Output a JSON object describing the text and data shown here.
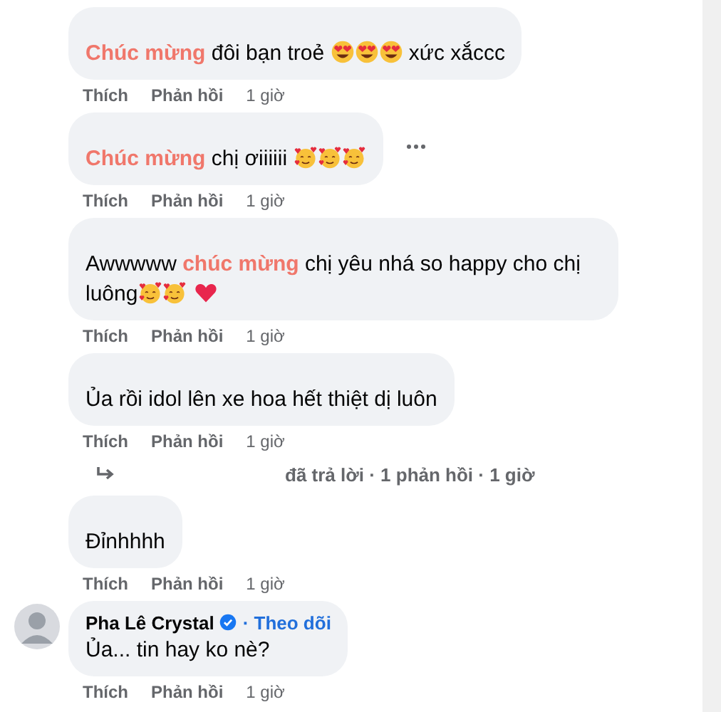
{
  "comments": [
    {
      "parts": [
        {
          "kind": "highlight",
          "text": "Chúc mừng"
        },
        {
          "kind": "text",
          "text": " đôi bạn troẻ "
        },
        {
          "kind": "emoji_heart_eyes"
        },
        {
          "kind": "emoji_heart_eyes"
        },
        {
          "kind": "emoji_heart_eyes"
        },
        {
          "kind": "text",
          "text": " xức xắccc"
        }
      ],
      "actions": [
        "Thích",
        "Phản hồi",
        "1 giờ"
      ],
      "more": false
    },
    {
      "parts": [
        {
          "kind": "highlight",
          "text": "Chúc mừng"
        },
        {
          "kind": "text",
          "text": " chị ơiiiiii "
        },
        {
          "kind": "emoji_hearts_face"
        },
        {
          "kind": "emoji_hearts_face"
        },
        {
          "kind": "emoji_hearts_face"
        }
      ],
      "actions": [
        "Thích",
        "Phản hồi",
        "1 giờ"
      ],
      "more": true
    },
    {
      "parts": [
        {
          "kind": "text",
          "text": "Awwwww "
        },
        {
          "kind": "highlight",
          "text": "chúc mừng"
        },
        {
          "kind": "text",
          "text": " chị yêu nhá so happy cho chị luông"
        },
        {
          "kind": "emoji_hearts_face"
        },
        {
          "kind": "emoji_hearts_face"
        },
        {
          "kind": "emoji_heart"
        }
      ],
      "actions": [
        "Thích",
        "Phản hồi",
        "1 giờ"
      ],
      "more": false
    },
    {
      "parts": [
        {
          "kind": "text",
          "text": "Ủa rồi idol lên xe hoa hết thiệt dị luôn"
        }
      ],
      "actions": [
        "Thích",
        "Phản hồi",
        "1 giờ"
      ],
      "more": false,
      "reply_summary": "đã trả lời · 1 phản hồi · 1 giờ"
    },
    {
      "parts": [
        {
          "kind": "text",
          "text": "Đỉnhhhh"
        }
      ],
      "actions": [
        "Thích",
        "Phản hồi",
        "1 giờ"
      ],
      "more": false
    },
    {
      "name": "Pha Lê Crystal",
      "verified": true,
      "follow": "· Theo dõi",
      "avatar": true,
      "parts": [
        {
          "kind": "text",
          "text": "Ủa... tin hay ko nè?"
        }
      ],
      "actions": [
        "Thích",
        "Phản hồi",
        "1 giờ"
      ],
      "more": false
    }
  ]
}
